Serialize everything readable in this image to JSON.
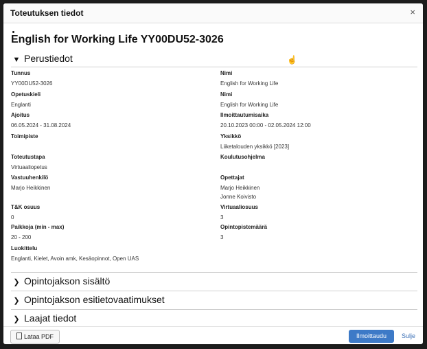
{
  "modal": {
    "title": "Toteutuksen tiedot",
    "close_glyph": "×"
  },
  "course_title": "English for Working Life YY00DU52-3026",
  "sections": {
    "basic": {
      "label": "Perustiedot",
      "expanded": true
    },
    "content": {
      "label": "Opintojakson sisältö"
    },
    "prereq": {
      "label": "Opintojakson esitietovaatimukset"
    },
    "extended": {
      "label": "Laajat tiedot"
    }
  },
  "fields": {
    "tunnus": {
      "label": "Tunnus",
      "value": "YY00DU52-3026"
    },
    "nimi1": {
      "label": "Nimi",
      "value": "English for Working Life"
    },
    "opetuskieli": {
      "label": "Opetuskieli",
      "value": "Englanti"
    },
    "nimi2": {
      "label": "Nimi",
      "value": "English for Working Life"
    },
    "ajoitus": {
      "label": "Ajoitus",
      "value": "06.05.2024 - 31.08.2024"
    },
    "ilmoittautumisaika": {
      "label": "Ilmoittautumisaika",
      "value": "20.10.2023 00:00 - 02.05.2024 12:00"
    },
    "toimipiste": {
      "label": "Toimipiste",
      "value": ""
    },
    "yksikko": {
      "label": "Yksikkö",
      "value": "Liiketalouden yksikkö [2023]"
    },
    "toteutustapa": {
      "label": "Toteutustapa",
      "value": "Virtuaaliopetus"
    },
    "koulutusohjelma": {
      "label": "Koulutusohjelma",
      "value": ""
    },
    "vastuuhenkilo": {
      "label": "Vastuuhenkilö",
      "value": "Marjo Heikkinen"
    },
    "opettajat": {
      "label": "Opettajat",
      "values": [
        "Marjo Heikkinen",
        "Jonne Koivisto"
      ]
    },
    "tk_osuus": {
      "label": "T&K osuus",
      "value": "0"
    },
    "virtuaaliosuus": {
      "label": "Virtuaaliosuus",
      "value": "3"
    },
    "paikkoja": {
      "label": "Paikkoja (min - max)",
      "value": "20 - 200"
    },
    "opintopistemaara": {
      "label": "Opintopistemäärä",
      "value": "3"
    },
    "luokittelu": {
      "label": "Luokittelu",
      "value": "Englanti, Kielet, Avoin amk, Kesäopinnot, Open UAS"
    }
  },
  "footer": {
    "pdf_label": "Lataa PDF",
    "signup_label": "Ilmoittaudu",
    "close_label": "Sulje"
  },
  "icons": {
    "chevron_down": "chevron-down-icon",
    "chevron_right": "chevron-right-icon",
    "pdf": "pdf-icon",
    "cursor": "hand-cursor-icon"
  },
  "colors": {
    "primary_button": "#3d7ac7",
    "link": "#3a6fb6"
  }
}
